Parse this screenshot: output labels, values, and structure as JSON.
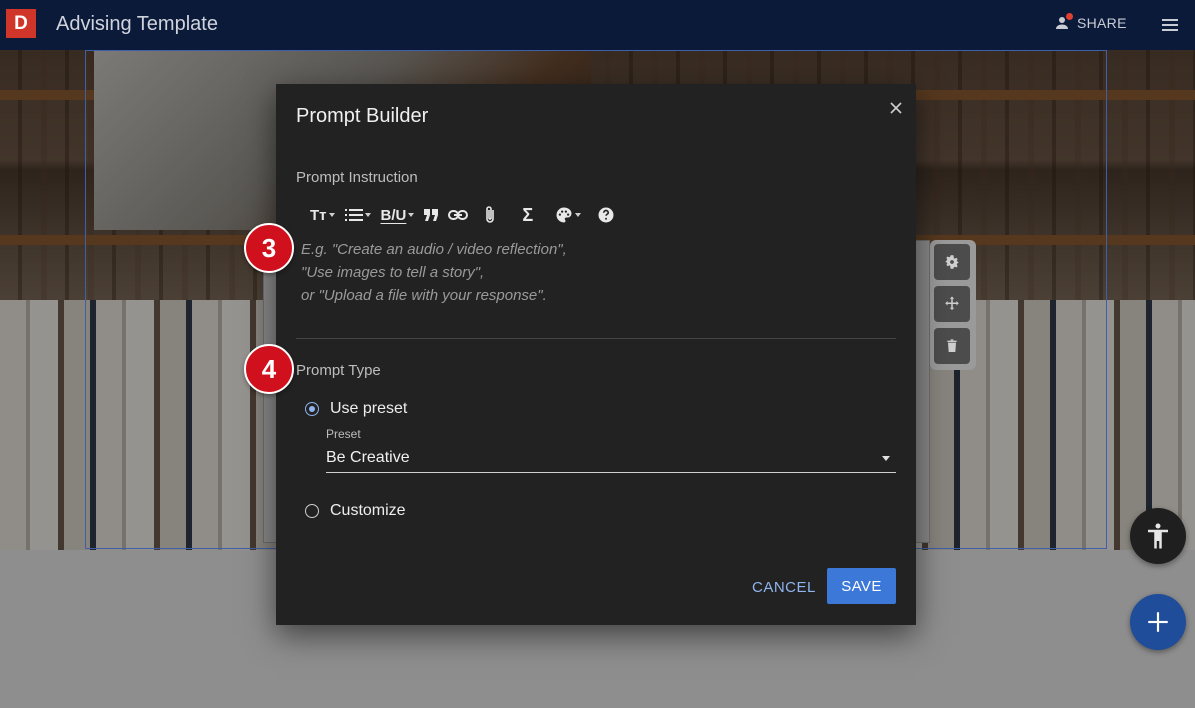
{
  "app": {
    "logo_letter": "D",
    "title": "Advising Template",
    "share_label": "SHARE"
  },
  "dialog": {
    "title": "Prompt Builder",
    "instruction_label": "Prompt Instruction",
    "toolbar": {
      "text_size": "Tт",
      "format": "B/U",
      "formula": "Σ"
    },
    "placeholder_lines": [
      "E.g. \"Create an audio / video reflection\",",
      "\"Use images to tell a story\",",
      "or \"Upload a file with your response\"."
    ],
    "prompt_type_label": "Prompt Type",
    "options": {
      "use_preset": "Use preset",
      "customize": "Customize"
    },
    "preset_label": "Preset",
    "preset_value": "Be Creative",
    "cancel_label": "CANCEL",
    "save_label": "SAVE"
  },
  "badges": {
    "step3": "3",
    "step4": "4"
  },
  "colors": {
    "appbar": "#0c1a3a",
    "dialog_bg": "#222222",
    "accent": "#3c78d8",
    "badge": "#d0101c"
  }
}
